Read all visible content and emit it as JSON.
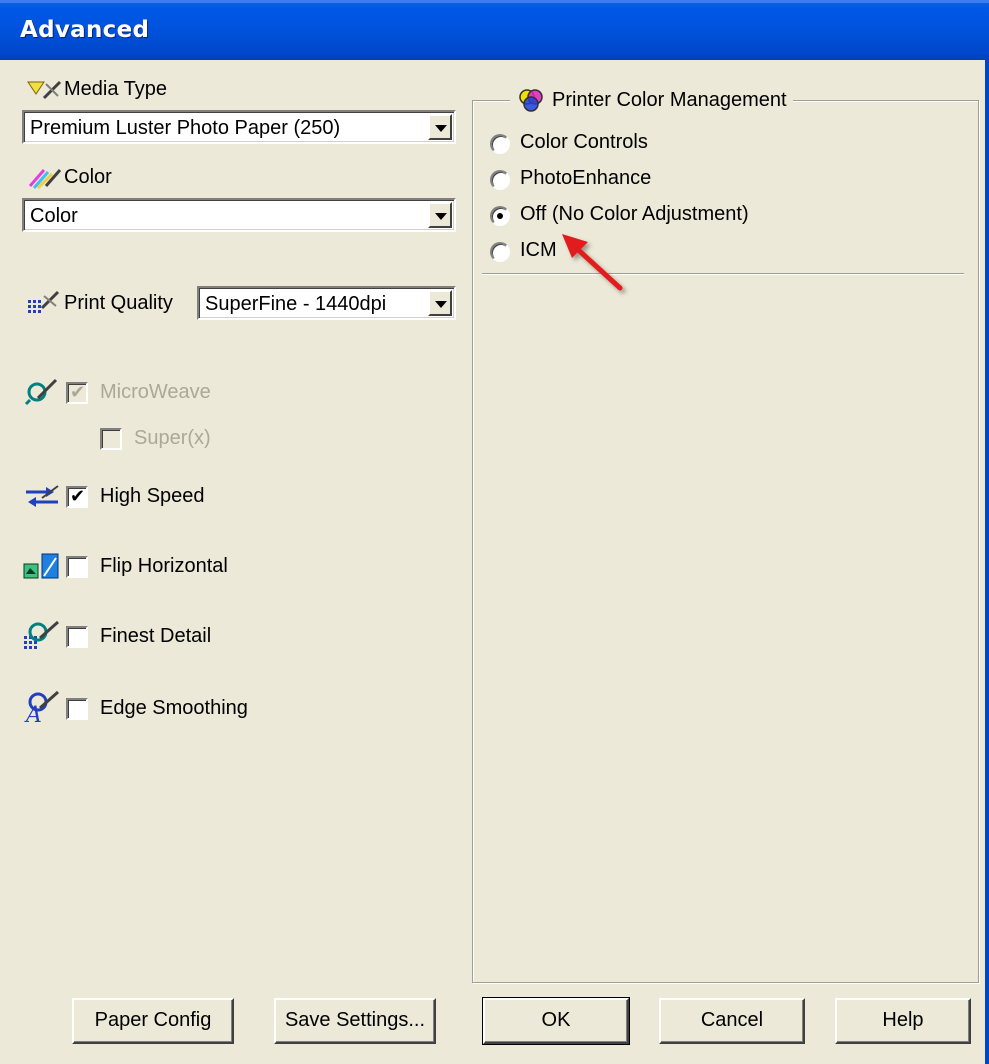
{
  "window": {
    "title": "Advanced"
  },
  "left": {
    "media_type": {
      "label": "Media Type",
      "value": "Premium Luster Photo Paper (250)"
    },
    "color": {
      "label": "Color",
      "value": "Color"
    },
    "print_quality": {
      "label": "Print Quality",
      "value": "SuperFine - 1440dpi"
    },
    "options": [
      {
        "label": "MicroWeave",
        "checked": true,
        "enabled": false
      },
      {
        "label": "Super(x)",
        "checked": false,
        "enabled": false
      },
      {
        "label": "High Speed",
        "checked": true,
        "enabled": true
      },
      {
        "label": "Flip Horizontal",
        "checked": false,
        "enabled": true
      },
      {
        "label": "Finest Detail",
        "checked": false,
        "enabled": true
      },
      {
        "label": "Edge Smoothing",
        "checked": false,
        "enabled": true
      }
    ]
  },
  "color_management": {
    "title": "Printer Color Management",
    "options": [
      {
        "label": "Color Controls",
        "selected": false
      },
      {
        "label": "PhotoEnhance",
        "selected": false
      },
      {
        "label": "Off (No Color Adjustment)",
        "selected": true
      },
      {
        "label": "ICM",
        "selected": false
      }
    ]
  },
  "buttons": {
    "paper_config": "Paper Config",
    "save_settings": "Save Settings...",
    "ok": "OK",
    "cancel": "Cancel",
    "help": "Help"
  },
  "colors": {
    "titlebar": "#0052DC",
    "dialog_bg": "#ECE9D8",
    "annotation_arrow": "#E21F1F"
  },
  "checkmark_glyph": "✔"
}
